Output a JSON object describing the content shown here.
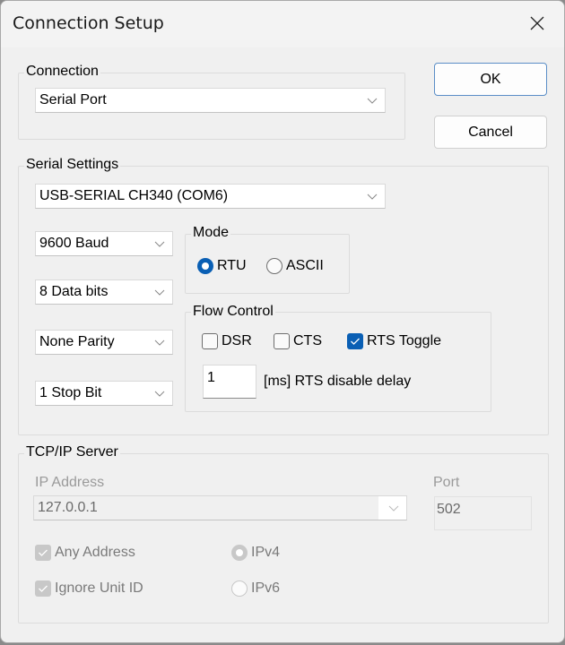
{
  "window": {
    "title": "Connection Setup"
  },
  "buttons": {
    "ok": "OK",
    "cancel": "Cancel"
  },
  "connection": {
    "label": "Connection",
    "type_value": "Serial Port"
  },
  "serial": {
    "label": "Serial Settings",
    "port_value": "USB-SERIAL CH340 (COM6)",
    "baud_value": "9600 Baud",
    "data_bits_value": "8 Data bits",
    "parity_value": "None Parity",
    "stop_bits_value": "1 Stop Bit",
    "mode": {
      "label": "Mode",
      "options": [
        {
          "label": "RTU",
          "selected": true
        },
        {
          "label": "ASCII",
          "selected": false
        }
      ]
    },
    "flow_control": {
      "label": "Flow Control",
      "dsr": {
        "label": "DSR",
        "checked": false
      },
      "cts": {
        "label": "CTS",
        "checked": false
      },
      "rts_toggle": {
        "label": "RTS Toggle",
        "checked": true
      },
      "rts_delay_value": "1",
      "rts_delay_label": "[ms] RTS disable delay"
    }
  },
  "tcpip": {
    "label": "TCP/IP Server",
    "ip_label": "IP Address",
    "ip_value": "127.0.0.1",
    "port_label": "Port",
    "port_value": "502",
    "any_address": {
      "label": "Any Address",
      "checked": true,
      "enabled": false
    },
    "ignore_unit_id": {
      "label": "Ignore Unit ID",
      "checked": true,
      "enabled": false
    },
    "ip_version": [
      {
        "label": "IPv4",
        "selected": true,
        "enabled": false
      },
      {
        "label": "IPv6",
        "selected": false,
        "enabled": false
      }
    ]
  },
  "colors": {
    "accent": "#0a5fb4",
    "disabled": "#c8c8c8"
  }
}
